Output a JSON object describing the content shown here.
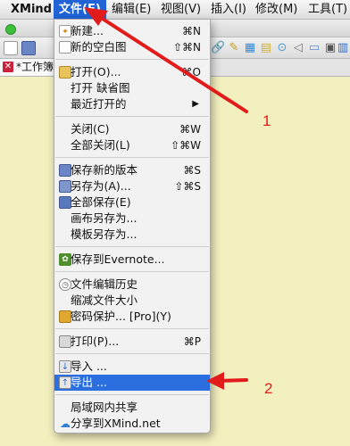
{
  "menubar": {
    "app_name": "XMind",
    "items": [
      "文件(F)",
      "编辑(E)",
      "视图(V)",
      "插入(I)",
      "修改(M)",
      "工具(T)"
    ]
  },
  "tab": {
    "label": "*工作簿 1"
  },
  "file_menu": {
    "items": [
      {
        "label": "新建...",
        "shortcut": "⌘N",
        "icon": "new-document-icon"
      },
      {
        "label": "新的空白图",
        "shortcut": "⇧⌘N",
        "icon": "new-blank-map-icon"
      },
      {
        "label": "打开(O)...",
        "shortcut": "⌘O",
        "icon": "open-folder-icon"
      },
      {
        "label": "打开 缺省图",
        "shortcut": ""
      },
      {
        "label": "最近打开的",
        "shortcut": "",
        "submenu": "▶"
      },
      {
        "label": "关闭(C)",
        "shortcut": "⌘W"
      },
      {
        "label": "全部关闭(L)",
        "shortcut": "⇧⌘W"
      },
      {
        "label": "保存新的版本",
        "shortcut": "⌘S",
        "icon": "save-icon"
      },
      {
        "label": "另存为(A)...",
        "shortcut": "⇧⌘S",
        "icon": "save-as-icon"
      },
      {
        "label": "全部保存(E)",
        "shortcut": "",
        "icon": "save-all-icon"
      },
      {
        "label": "画布另存为...",
        "shortcut": ""
      },
      {
        "label": "模板另存为...",
        "shortcut": ""
      },
      {
        "label": "保存到Evernote...",
        "shortcut": "",
        "icon": "evernote-icon"
      },
      {
        "label": "文件编辑历史",
        "shortcut": "",
        "icon": "history-clock-icon"
      },
      {
        "label": "缩减文件大小",
        "shortcut": ""
      },
      {
        "label": "密码保护... [Pro](Y)",
        "shortcut": "",
        "icon": "lock-icon"
      },
      {
        "label": "打印(P)...",
        "shortcut": "⌘P",
        "icon": "printer-icon"
      },
      {
        "label": "导入 ...",
        "shortcut": "",
        "icon": "import-icon"
      },
      {
        "label": "导出 ...",
        "shortcut": "",
        "icon": "export-icon",
        "highlighted": true
      },
      {
        "label": "局域网内共享",
        "shortcut": ""
      },
      {
        "label": "分享到XMind.net",
        "shortcut": "",
        "icon": "cloud-share-icon"
      }
    ]
  },
  "annotations": {
    "label_1": "1",
    "label_2": "2"
  },
  "colors": {
    "highlight": "#2a6ee0",
    "menubar_active": "#1f63d6",
    "annotation_red": "#e21b1b",
    "canvas_background": "#f3f0bf"
  }
}
